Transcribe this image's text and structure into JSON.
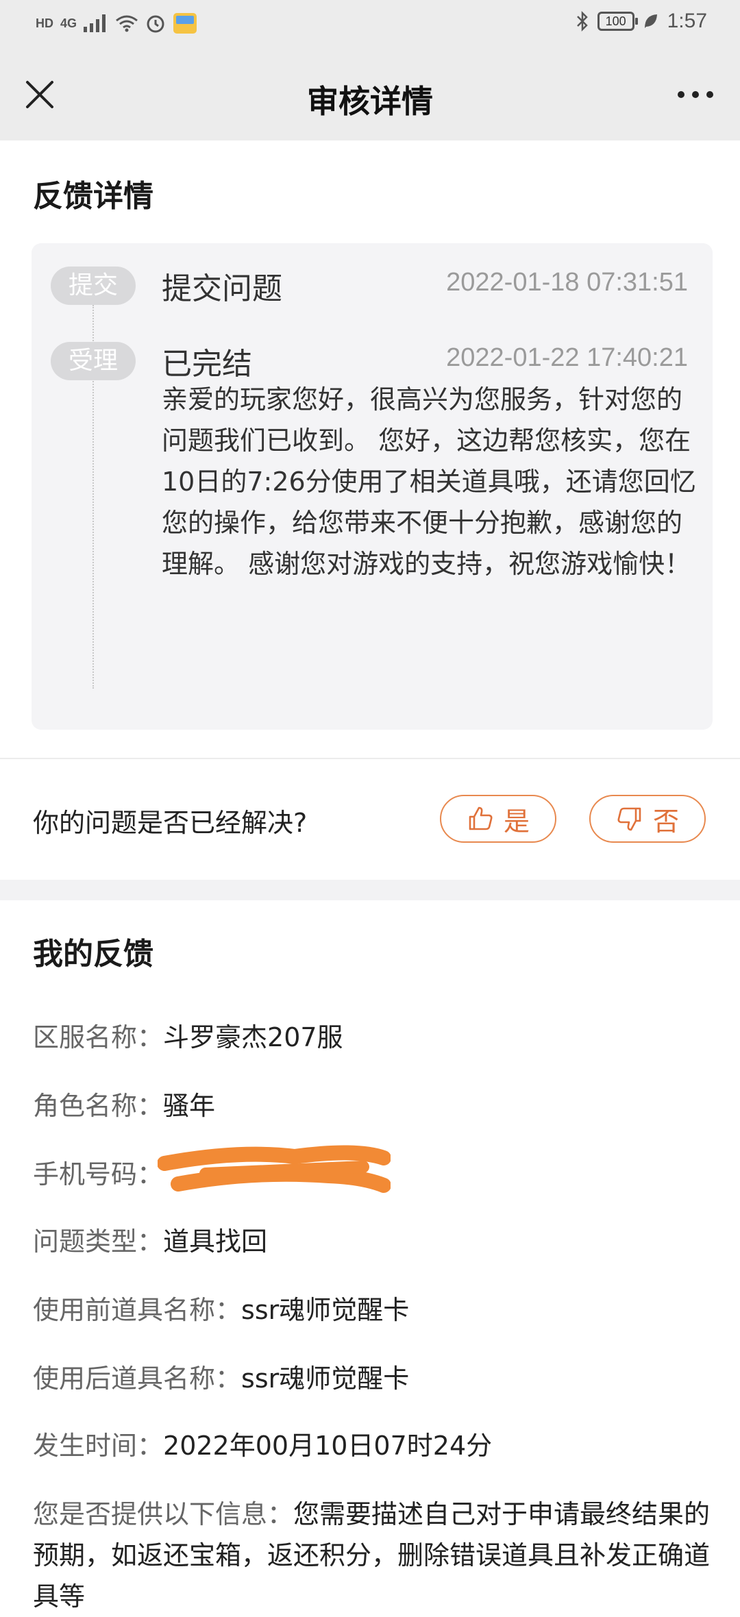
{
  "status_bar": {
    "left_indicators": [
      "HD",
      "4G"
    ],
    "time": "1:57",
    "battery": "100"
  },
  "app_bar": {
    "title": "审核详情"
  },
  "feedback_detail": {
    "section_title": "反馈详情",
    "timeline": [
      {
        "badge": "提交",
        "title": "提交问题",
        "time": "2022-01-18 07:31:51"
      },
      {
        "badge": "受理",
        "title": "已完结",
        "time": "2022-01-22 17:40:21",
        "body": "亲爱的玩家您好，很高兴为您服务，针对您的问题我们已收到。 您好，这边帮您核实，您在10日的7:26分使用了相关道具哦，还请您回忆您的操作，给您带来不便十分抱歉，感谢您的理解。 感谢您对游戏的支持，祝您游戏愉快！"
      }
    ]
  },
  "resolution": {
    "question": "你的问题是否已经解决?",
    "yes_label": "是",
    "no_label": "否",
    "accent_color": "#e8894f"
  },
  "my_feedback": {
    "section_title": "我的反馈",
    "fields": [
      {
        "label": "区服名称：",
        "value": "斗罗豪杰207服"
      },
      {
        "label": "角色名称：",
        "value": "骚年"
      },
      {
        "label": "手机号码：",
        "value": ""
      },
      {
        "label": "问题类型：",
        "value": "道具找回"
      },
      {
        "label": "使用前道具名称：",
        "value": "ssr魂师觉醒卡"
      },
      {
        "label": "使用后道具名称：",
        "value": "ssr魂师觉醒卡"
      },
      {
        "label": "发生时间：",
        "value": "2022年00月10日07时24分"
      },
      {
        "label": "您是否提供以下信息：",
        "value": "您需要描述自己对于申请最终结果的预期，如返还宝箱，返还积分，删除错误道具且补发正确道具等"
      }
    ]
  }
}
